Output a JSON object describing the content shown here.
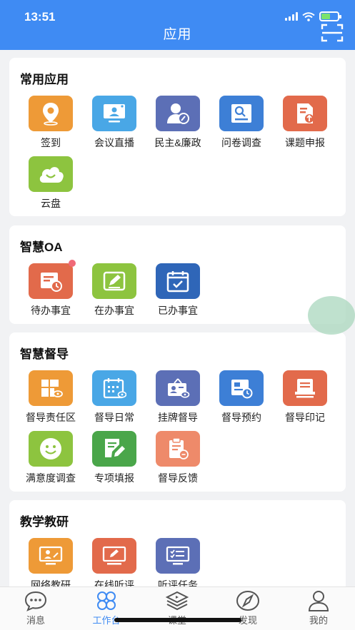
{
  "status_bar": {
    "time": "13:51"
  },
  "header": {
    "title": "应用"
  },
  "sections": [
    {
      "title": "常用应用",
      "apps": [
        {
          "label": "签到",
          "icon": "location-pin-icon",
          "color": "#ee9a37"
        },
        {
          "label": "会议直播",
          "icon": "monitor-live-icon",
          "color": "#49a7e6"
        },
        {
          "label": "民主&廉政",
          "icon": "user-edit-icon",
          "color": "#5c6fb6"
        },
        {
          "label": "问卷调查",
          "icon": "survey-icon",
          "color": "#3d7fd6"
        },
        {
          "label": "课题申报",
          "icon": "document-upload-icon",
          "color": "#e26a4b"
        },
        {
          "label": "云盘",
          "icon": "cloud-icon",
          "color": "#8dc43f"
        }
      ]
    },
    {
      "title": "智慧OA",
      "apps": [
        {
          "label": "待办事宜",
          "icon": "pending-clock-icon",
          "color": "#e26a4b",
          "badge": true
        },
        {
          "label": "在办事宜",
          "icon": "edit-doc-icon",
          "color": "#8dc43f"
        },
        {
          "label": "已办事宜",
          "icon": "calendar-check-icon",
          "color": "#2f66b8"
        }
      ]
    },
    {
      "title": "智慧督导",
      "apps": [
        {
          "label": "督导责任区",
          "icon": "grid-area-icon",
          "color": "#ee9a37"
        },
        {
          "label": "督导日常",
          "icon": "calendar-icon",
          "color": "#49a7e6"
        },
        {
          "label": "挂牌督导",
          "icon": "id-badge-icon",
          "color": "#5c6fb6"
        },
        {
          "label": "督导预约",
          "icon": "appointment-icon",
          "color": "#3d7fd6"
        },
        {
          "label": "督导印记",
          "icon": "stamp-icon",
          "color": "#e26a4b"
        },
        {
          "label": "满意度调查",
          "icon": "smile-icon",
          "color": "#8dc43f"
        },
        {
          "label": "专项填报",
          "icon": "form-edit-icon",
          "color": "#4aa64a"
        },
        {
          "label": "督导反馈",
          "icon": "feedback-icon",
          "color": "#ee8a6a"
        }
      ]
    },
    {
      "title": "教学教研",
      "apps": [
        {
          "label": "网络教研",
          "icon": "online-teaching-icon",
          "color": "#ee9a37"
        },
        {
          "label": "在线听评",
          "icon": "online-review-icon",
          "color": "#e26a4b"
        },
        {
          "label": "听评任务",
          "icon": "task-list-icon",
          "color": "#5c6fb6"
        }
      ]
    }
  ],
  "tabbar": [
    {
      "label": "消息",
      "icon": "message-icon"
    },
    {
      "label": "工作台",
      "icon": "workbench-icon",
      "active": true
    },
    {
      "label": "课堂",
      "icon": "classroom-icon"
    },
    {
      "label": "发现",
      "icon": "compass-icon"
    },
    {
      "label": "我的",
      "icon": "profile-icon"
    }
  ],
  "colors": {
    "primary": "#3f8bf3",
    "background": "#f1f2f4",
    "badge": "#f06a78"
  }
}
